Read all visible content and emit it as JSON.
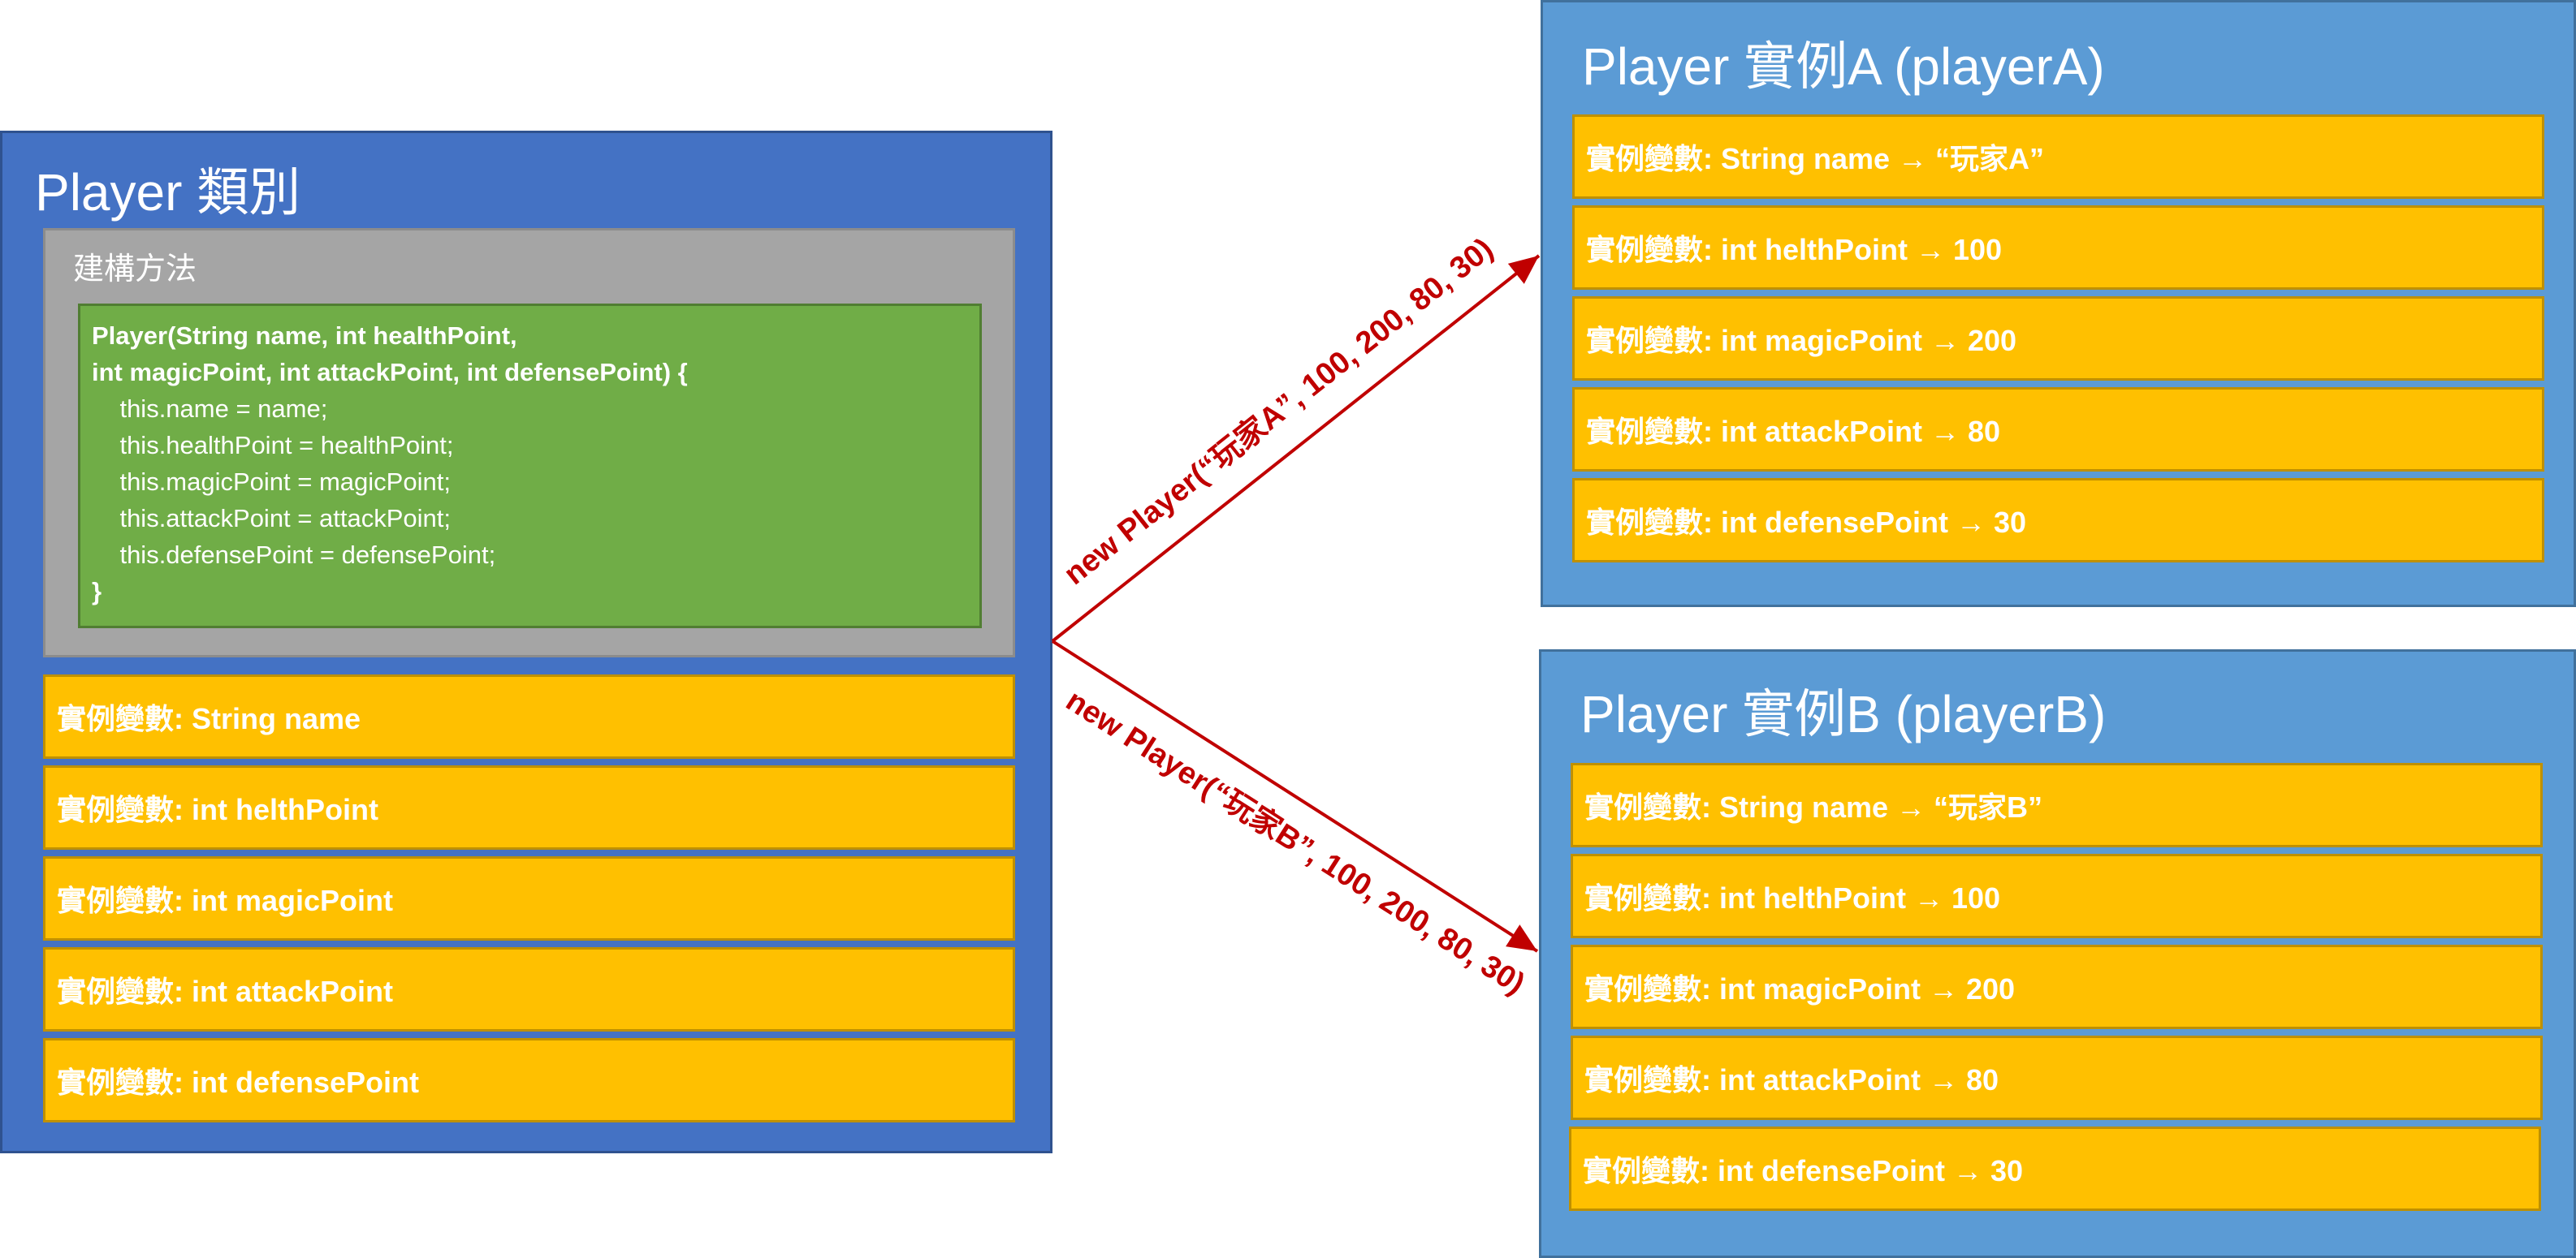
{
  "class_box": {
    "title": "Player 類別",
    "constructor_title": "建構方法",
    "constructor_code": [
      "Player(String name, int healthPoint,",
      "int magicPoint, int attackPoint, int defensePoint) {",
      "    this.name = name;",
      "    this.healthPoint = healthPoint;",
      "    this.magicPoint = magicPoint;",
      "    this.attackPoint = attackPoint;",
      "    this.defensePoint = defensePoint;",
      "}"
    ],
    "fields": [
      "實例變數: String name",
      "實例變數: int helthPoint",
      "實例變數: int magicPoint",
      "實例變數: int attackPoint",
      "實例變數: int defensePoint"
    ]
  },
  "instance_a": {
    "title": "Player 實例A (playerA)",
    "fields": [
      "實例變數: String name → “玩家A”",
      "實例變數: int helthPoint → 100",
      "實例變數: int magicPoint → 200",
      "實例變數: int attackPoint  → 80",
      "實例變數: int defensePoint  → 30"
    ]
  },
  "instance_b": {
    "title": "Player 實例B (playerB)",
    "fields": [
      "實例變數: String name → “玩家B”",
      "實例變數: int helthPoint → 100",
      "實例變數: int magicPoint → 200",
      "實例變數: int attackPoint  → 80",
      "實例變數: int defensePoint  → 30"
    ]
  },
  "arrows": {
    "to_a_label": "new Player(“玩家A”, 100, 200, 80, 30)",
    "to_b_label": "new Player(“玩家B”, 100, 200, 80, 30)"
  },
  "colors": {
    "class_box": "#4472c4",
    "constructor_box": "#a5a5a5",
    "code_box": "#70ad47",
    "field": "#ffc000",
    "instance_box": "#5b9bd5",
    "arrow": "#c00000"
  }
}
